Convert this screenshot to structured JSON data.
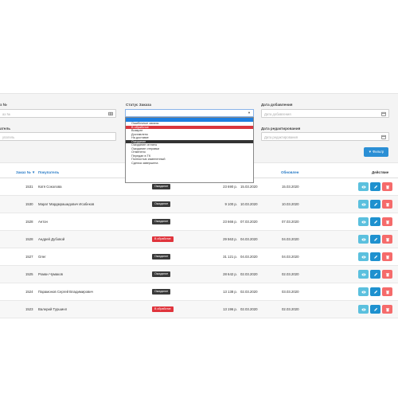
{
  "filters": {
    "order_label": "з №",
    "order_placeholder": "аз №",
    "buyer_label": "атель",
    "buyer_placeholder": "упатель",
    "status_label": "Статус Заказа",
    "date_added_label": "Дата добавления",
    "date_added_placeholder": "Дата добавления",
    "date_modified_label": "Дата редактирования",
    "date_modified_placeholder": "Дата редактирования",
    "filter_button": "Фильтр"
  },
  "status_options": [
    "",
    "Ошибочные заказы",
    "В обработке",
    "Возврат",
    "Доставлено",
    "На доставке",
    "Ожидание",
    "Ожидание оплаты",
    "Ожидание отправки",
    "Отменено",
    "Передан в ТК",
    "Полностью измененный",
    "Сделка завершена"
  ],
  "table": {
    "headers": {
      "order_no": "Заказ № ▼",
      "buyer": "Покупатель",
      "modified": "Обновлен",
      "actions": "Действие"
    },
    "rows": [
      {
        "id": "1531",
        "buyer": "Катя Соколова",
        "status": "Ожидание",
        "status_type": "dark",
        "total": "23 690 р.",
        "added": "15.03.2020",
        "modified": "15.03.2020"
      },
      {
        "id": "1530",
        "buyer": "Марат Мардмрашидович Исабеков",
        "status": "Ожидание",
        "status_type": "dark",
        "total": "9 100 р.",
        "added": "10.03.2020",
        "modified": "10.03.2020"
      },
      {
        "id": "1528",
        "buyer": "Антон",
        "status": "Ожидание",
        "status_type": "dark",
        "total": "23 666 р.",
        "added": "07.03.2020",
        "modified": "07.03.2020"
      },
      {
        "id": "1528",
        "buyer": "Андрей Дубовой",
        "status": "В обработке",
        "status_type": "red",
        "total": "29 563 р.",
        "added": "04.03.2020",
        "modified": "04.03.2020"
      },
      {
        "id": "1527",
        "buyer": "Олег",
        "status": "Ожидание",
        "status_type": "dark",
        "total": "31 121 р.",
        "added": "04.03.2020",
        "modified": "04.03.2020"
      },
      {
        "id": "1525",
        "buyer": "Роман Чумаков",
        "status": "Ожидание",
        "status_type": "dark",
        "total": "28 642 р.",
        "added": "02.03.2020",
        "modified": "02.03.2020"
      },
      {
        "id": "1524",
        "buyer": "Парамонов Сергей Владимирович",
        "status": "Ожидание",
        "status_type": "dark",
        "total": "13 138 р.",
        "added": "02.03.2020",
        "modified": "03.03.2020"
      },
      {
        "id": "1523",
        "buyer": "Валерий Туршинл",
        "status": "В обработке",
        "status_type": "red",
        "total": "13 196 р.",
        "added": "02.03.2020",
        "modified": "02.03.2020"
      }
    ]
  },
  "colors": {
    "view_button": "#5bc0de",
    "edit_button": "#1e91cf",
    "delete_button": "#f56b6b",
    "status_dark": "#3a3a3a",
    "status_red": "#e0343c",
    "accent": "#2b8fd5"
  },
  "icons": {
    "view": "eye-icon",
    "edit": "pencil-icon",
    "delete": "trash-icon",
    "calendar": "calendar-icon",
    "filter": "filter-icon"
  }
}
